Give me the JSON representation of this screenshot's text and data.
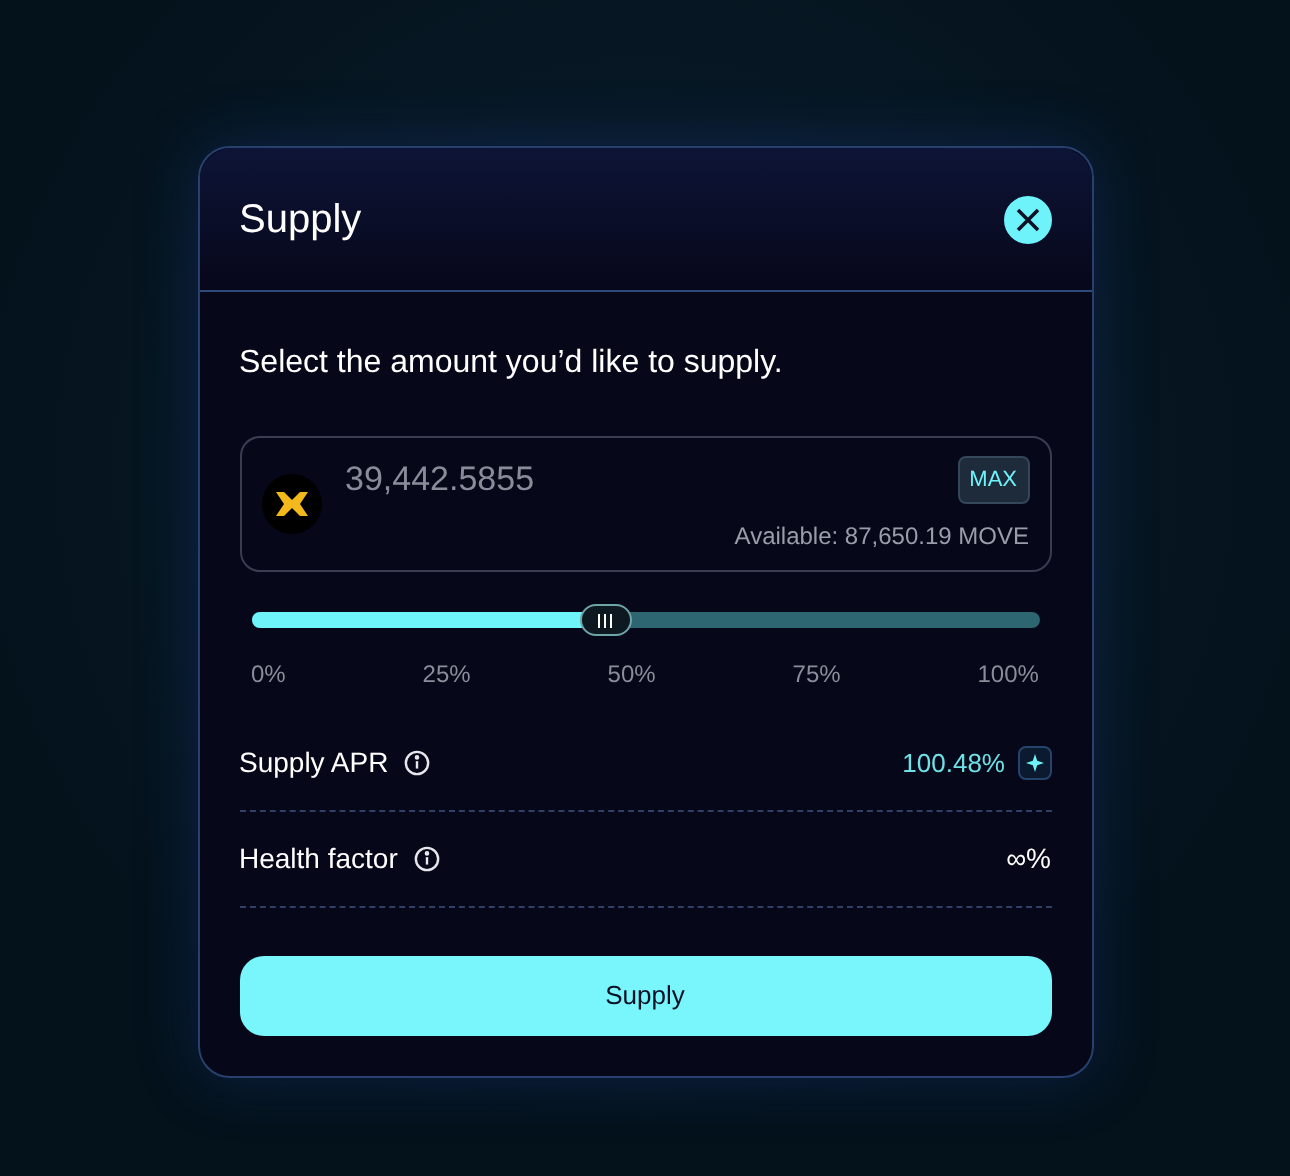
{
  "dialog": {
    "title": "Supply",
    "prompt": "Select the amount you’d like to supply.",
    "amount": {
      "value": "39,442.5855",
      "max_label": "MAX",
      "available": "Available: 87,650.19 MOVE"
    },
    "slider": {
      "level": 0.45,
      "ticks": [
        "0%",
        "25%",
        "50%",
        "75%",
        "100%"
      ]
    },
    "rows": [
      {
        "label": "Supply APR",
        "value": "100.48%",
        "kind": "apr"
      },
      {
        "label": "Health factor",
        "value": "∞%",
        "kind": "plain"
      }
    ],
    "submit": "Supply"
  }
}
